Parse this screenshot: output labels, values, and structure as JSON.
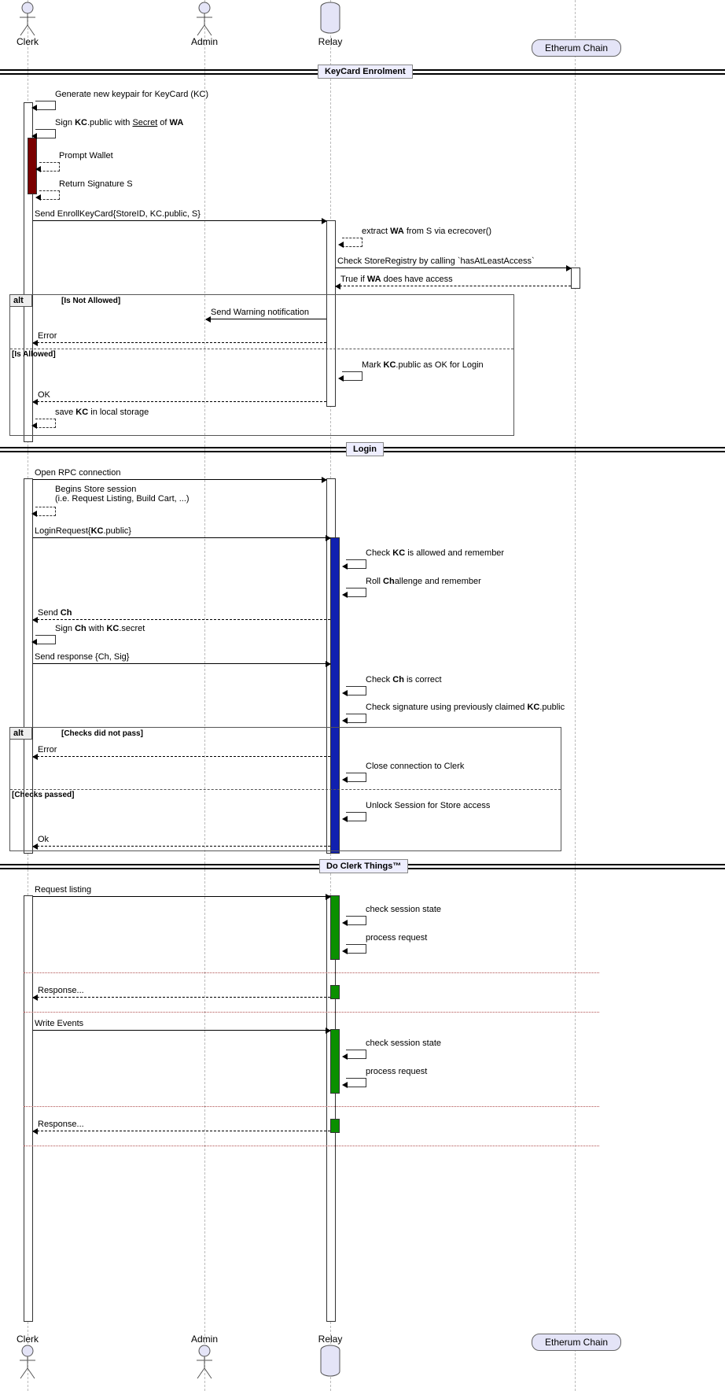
{
  "actors": {
    "clerk": "Clerk",
    "admin": "Admin",
    "relay": "Relay",
    "chain": "Etherum Chain"
  },
  "sections": {
    "enrolment": "KeyCard Enrolment",
    "login": "Login",
    "things": "Do Clerk Things™"
  },
  "enrolment": {
    "genKeypair": "Generate new keypair for KeyCard (KC)",
    "signPublicA": "Sign ",
    "signPublicB": "KC",
    "signPublicC": ".public with ",
    "signPublicD": "Secret",
    "signPublicE": " of ",
    "signPublicF": "WA",
    "promptWallet": "Prompt Wallet",
    "returnSig": "Return Signature S",
    "sendEnroll": "Send EnrollKeyCard{StoreID, KC.public, S}",
    "extractWA_a": "extract ",
    "extractWA_b": "WA",
    "extractWA_c": " from S via ecrecover()",
    "checkRegistry": "Check StoreRegistry by calling `hasAtLeastAccess`",
    "trueIf_a": "True if ",
    "trueIf_b": "WA",
    "trueIf_c": " does have access",
    "alt": {
      "label": "alt",
      "cond1": "[Is Not Allowed]",
      "cond2": "[Is Allowed]",
      "warn": "Send Warning notification",
      "error": "Error",
      "markOk_a": "Mark ",
      "markOk_b": "KC",
      "markOk_c": ".public as OK for Login",
      "ok": "OK",
      "saveKC_a": "save ",
      "saveKC_b": "KC",
      "saveKC_c": " in local storage"
    }
  },
  "login": {
    "openRpc": "Open RPC connection",
    "beginsA": "Begins Store session",
    "beginsB": "(i.e. Request Listing, Build Cart, ...)",
    "loginReq_a": "LoginRequest{",
    "loginReq_b": "KC",
    "loginReq_c": ".public}",
    "checkKC_a": "Check ",
    "checkKC_b": "KC",
    "checkKC_c": " is allowed and remember",
    "rollCh_a": "Roll ",
    "rollCh_b": "Ch",
    "rollCh_c": "allenge and remember",
    "sendCh_a": "Send ",
    "sendCh_b": "Ch",
    "signCh_a": "Sign ",
    "signCh_b": "Ch",
    "signCh_c": " with ",
    "signCh_d": "KC",
    "signCh_e": ".secret",
    "sendResp": "Send response {Ch, Sig}",
    "checkCh_a": "Check ",
    "checkCh_b": "Ch",
    "checkCh_c": " is correct",
    "checkSig_a": "Check signature using previously claimed ",
    "checkSig_b": "KC",
    "checkSig_c": ".public",
    "alt": {
      "label": "alt",
      "cond1": "[Checks did not pass]",
      "cond2": "[Checks passed]",
      "error": "Error",
      "closeConn": "Close connection to Clerk",
      "unlock": "Unlock Session for Store access",
      "ok": "Ok"
    }
  },
  "things": {
    "reqListing": "Request listing",
    "checkSession": "check session state",
    "procReq": "process request",
    "response": "Response...",
    "writeEvents": "Write Events"
  }
}
